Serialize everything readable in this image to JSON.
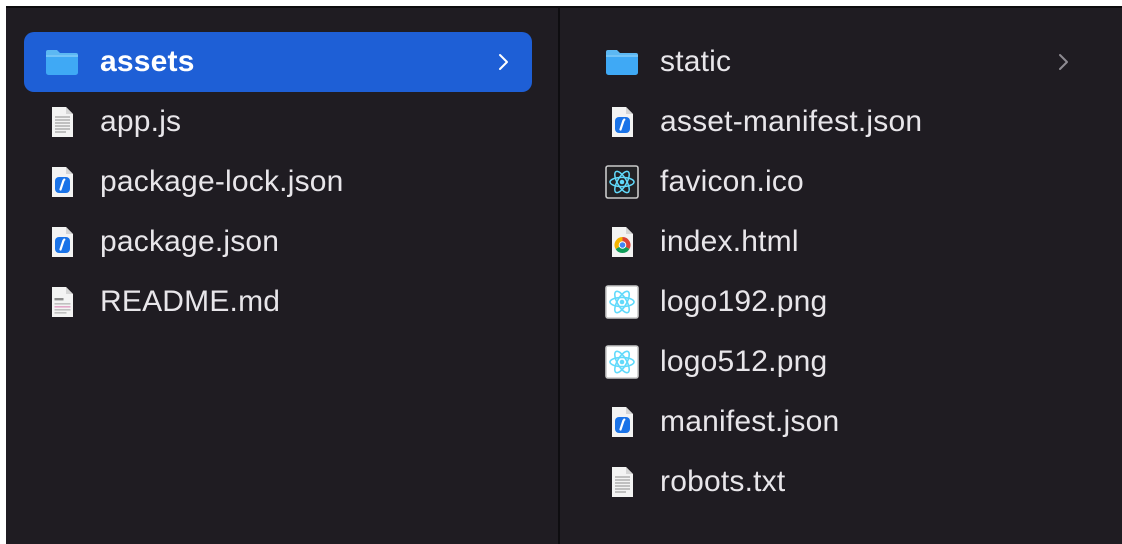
{
  "left_column": {
    "items": [
      {
        "name": "assets",
        "type": "folder",
        "selected": true,
        "has_children": true
      },
      {
        "name": "app.js",
        "type": "text-file"
      },
      {
        "name": "package-lock.json",
        "type": "json-file"
      },
      {
        "name": "package.json",
        "type": "json-file"
      },
      {
        "name": "README.md",
        "type": "markdown-file"
      }
    ]
  },
  "right_column": {
    "items": [
      {
        "name": "static",
        "type": "folder",
        "has_children": true
      },
      {
        "name": "asset-manifest.json",
        "type": "json-file"
      },
      {
        "name": "favicon.ico",
        "type": "react-icon"
      },
      {
        "name": "index.html",
        "type": "chrome-html"
      },
      {
        "name": "logo192.png",
        "type": "react-image"
      },
      {
        "name": "logo512.png",
        "type": "react-image"
      },
      {
        "name": "manifest.json",
        "type": "json-file"
      },
      {
        "name": "robots.txt",
        "type": "text-file"
      }
    ]
  },
  "colors": {
    "background": "#1f1c22",
    "selection": "#1e5fd6",
    "text": "#e8e6ea",
    "folder": "#3fa9f5"
  }
}
